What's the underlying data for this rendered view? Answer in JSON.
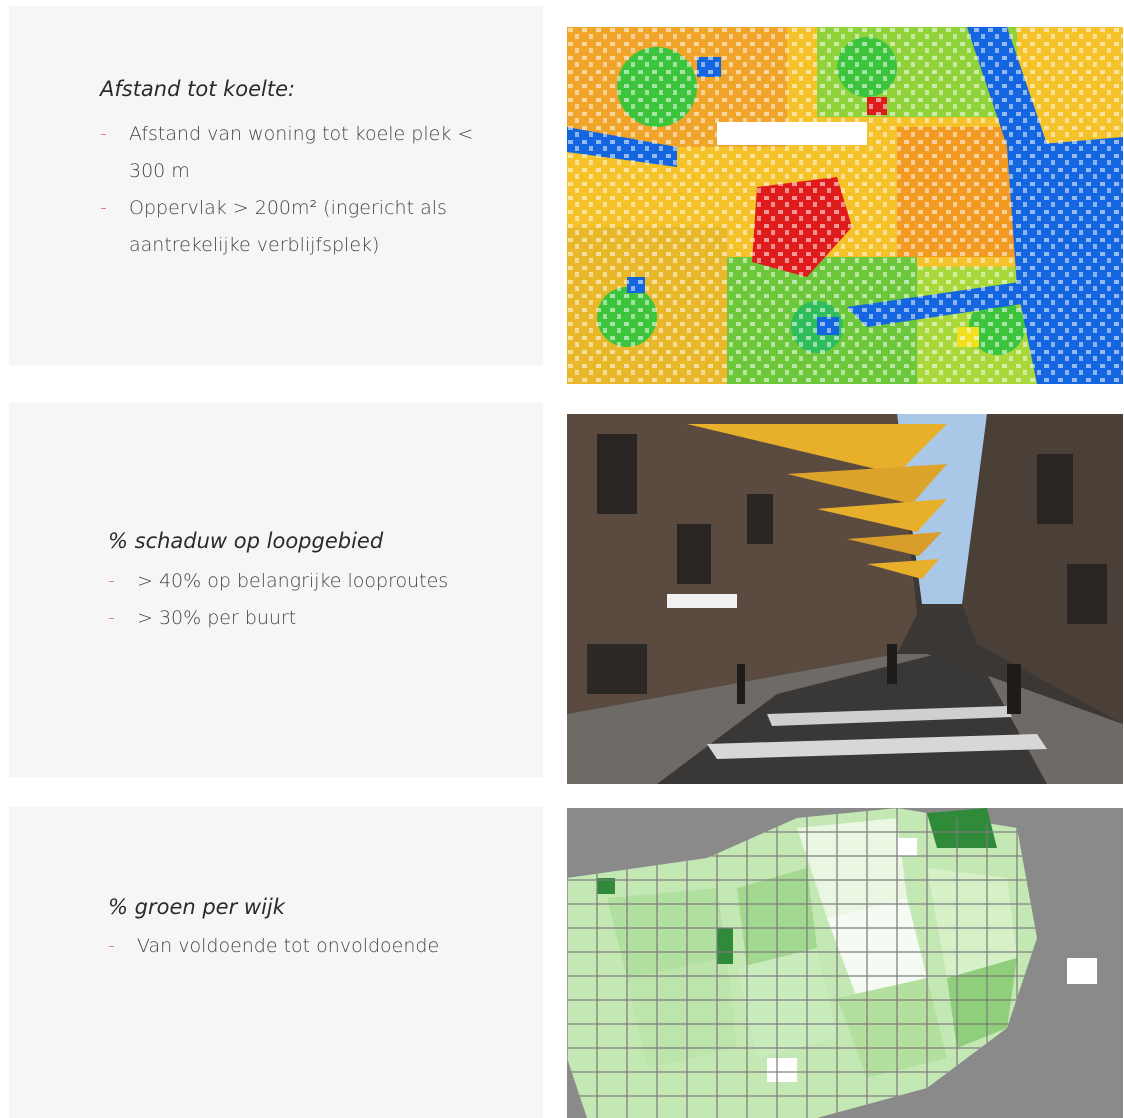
{
  "sections": [
    {
      "heading": "Afstand tot koelte:",
      "bullets": [
        "Afstand van woning tot koele plek < 300 m",
        "Oppervlak > 200m² (ingericht als aantrekelijke verblijfsplek)"
      ]
    },
    {
      "heading": "% schaduw op loopgebied",
      "bullets": [
        "> 40% op belangrijke looproutes",
        "> 30% per buurt"
      ]
    },
    {
      "heading": "% groen per wijk",
      "bullets": [
        "Van voldoende tot onvoldoende"
      ]
    }
  ],
  "bullet_marker": "-",
  "colors": {
    "panel_background": "#f6f6f6",
    "bullet_marker": "#e05a5a",
    "heat_red": "#e01b1b",
    "heat_orange": "#f5a020",
    "heat_yellow": "#f2e01c",
    "heat_green": "#36c636",
    "heat_blue": "#1466e0",
    "shade_sail": "#e8b02a",
    "green_dark": "#2f8a3a",
    "green_light": "#c9ecbd"
  },
  "images": [
    {
      "icon": "heat-distance-map"
    },
    {
      "icon": "shaded-street-photo"
    },
    {
      "icon": "green-per-district-map"
    }
  ]
}
